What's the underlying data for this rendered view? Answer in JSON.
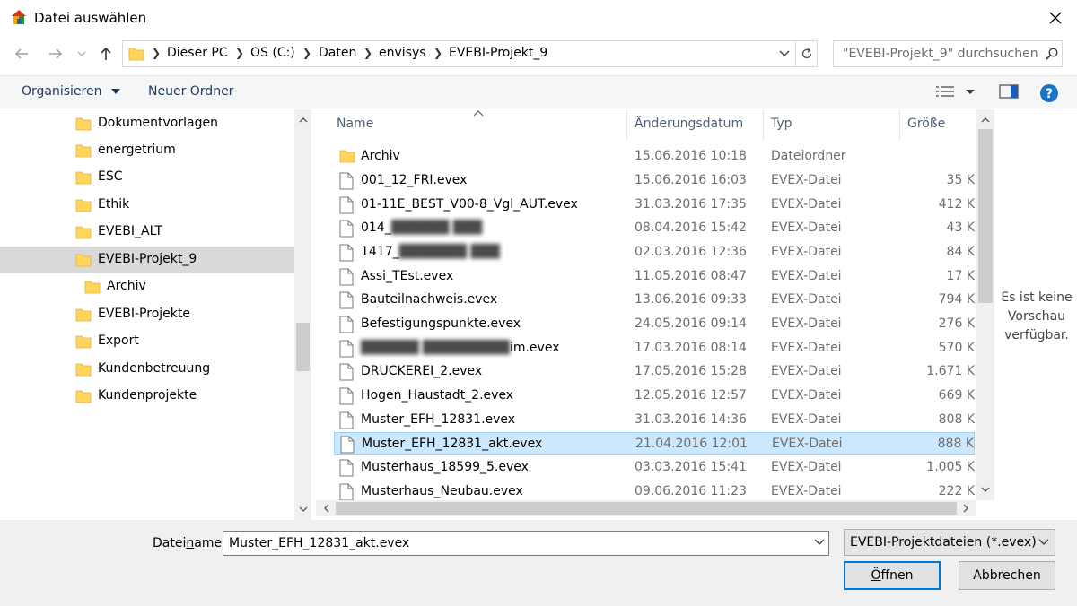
{
  "window": {
    "title": "Datei auswählen"
  },
  "address": {
    "crumbs": [
      "Dieser PC",
      "OS (C:)",
      "Daten",
      "envisys",
      "EVEBI-Projekt_9"
    ],
    "search_placeholder": "\"EVEBI-Projekt_9\" durchsuchen"
  },
  "toolbar": {
    "organize": "Organisieren",
    "new_folder": "Neuer Ordner"
  },
  "nav": {
    "items": [
      {
        "label": "Dokumentvorlagen"
      },
      {
        "label": "energetrium"
      },
      {
        "label": "ESC"
      },
      {
        "label": "Ethik"
      },
      {
        "label": "EVEBI_ALT"
      },
      {
        "label": "EVEBI-Projekt_9"
      },
      {
        "label": "Archiv"
      },
      {
        "label": "EVEBI-Projekte"
      },
      {
        "label": "Export"
      },
      {
        "label": "Kundenbetreuung"
      },
      {
        "label": "Kundenprojekte"
      }
    ]
  },
  "list": {
    "columns": {
      "name": "Name",
      "date": "Änderungsdatum",
      "type": "Typ",
      "size": "Größe"
    },
    "rows": [
      {
        "name": "Archiv",
        "date": "15.06.2016 10:18",
        "type": "Dateiordner",
        "size": ""
      },
      {
        "name": "001_12_FRI.evex",
        "date": "15.06.2016 16:03",
        "type": "EVEX-Datei",
        "size": "35 K"
      },
      {
        "name": "01-11E_BEST_V00-8_Vgl_AUT.evex",
        "date": "31.03.2016 17:35",
        "type": "EVEX-Datei",
        "size": "412 K"
      },
      {
        "name": "014_",
        "date": "08.04.2016 15:42",
        "type": "EVEX-Datei",
        "size": "43 K"
      },
      {
        "name": "1417_",
        "date": "02.03.2016 12:36",
        "type": "EVEX-Datei",
        "size": "84 K"
      },
      {
        "name": "Assi_TEst.evex",
        "date": "11.05.2016 08:47",
        "type": "EVEX-Datei",
        "size": "17 K"
      },
      {
        "name": "Bauteilnachweis.evex",
        "date": "13.06.2016 09:33",
        "type": "EVEX-Datei",
        "size": "794 K"
      },
      {
        "name": "Befestigungspunkte.evex",
        "date": "24.05.2016 09:14",
        "type": "EVEX-Datei",
        "size": "276 K"
      },
      {
        "name": "im.evex",
        "date": "17.03.2016 08:14",
        "type": "EVEX-Datei",
        "size": "570 K"
      },
      {
        "name": "DRUCKEREI_2.evex",
        "date": "17.05.2016 15:28",
        "type": "EVEX-Datei",
        "size": "1.671 K"
      },
      {
        "name": "Hogen_Haustadt_2.evex",
        "date": "12.05.2016 12:57",
        "type": "EVEX-Datei",
        "size": "669 K"
      },
      {
        "name": "Muster_EFH_12831.evex",
        "date": "31.03.2016 14:36",
        "type": "EVEX-Datei",
        "size": "808 K"
      },
      {
        "name": "Muster_EFH_12831_akt.evex",
        "date": "21.04.2016 12:01",
        "type": "EVEX-Datei",
        "size": "888 K"
      },
      {
        "name": "Musterhaus_18599_5.evex",
        "date": "03.03.2016 15:41",
        "type": "EVEX-Datei",
        "size": "1.005 K"
      },
      {
        "name": "Musterhaus_Neubau.evex",
        "date": "09.06.2016 11:23",
        "type": "EVEX-Datei",
        "size": "222 K"
      }
    ]
  },
  "preview": {
    "text": "Es ist keine Vorschau verfügbar."
  },
  "footer": {
    "filename_label_pre": "Datei",
    "filename_label_ul": "n",
    "filename_label_post": "ame:",
    "filename_value": "Muster_EFH_12831_akt.evex",
    "filter": "EVEBI-Projektdateien (*.evex)",
    "open_ul": "Ö",
    "open_rest": "ffnen",
    "cancel": "Abbrechen"
  },
  "colors": {
    "accent": "#0078d7",
    "selection": "#cce8ff",
    "folder": "#ffd55c"
  },
  "icons": [
    "app-house-icon",
    "close-icon",
    "back-arrow-icon",
    "forward-arrow-icon",
    "up-arrow-icon",
    "folder-icon",
    "refresh-icon",
    "search-icon",
    "view-options-icon",
    "preview-pane-icon",
    "help-icon",
    "file-icon"
  ]
}
